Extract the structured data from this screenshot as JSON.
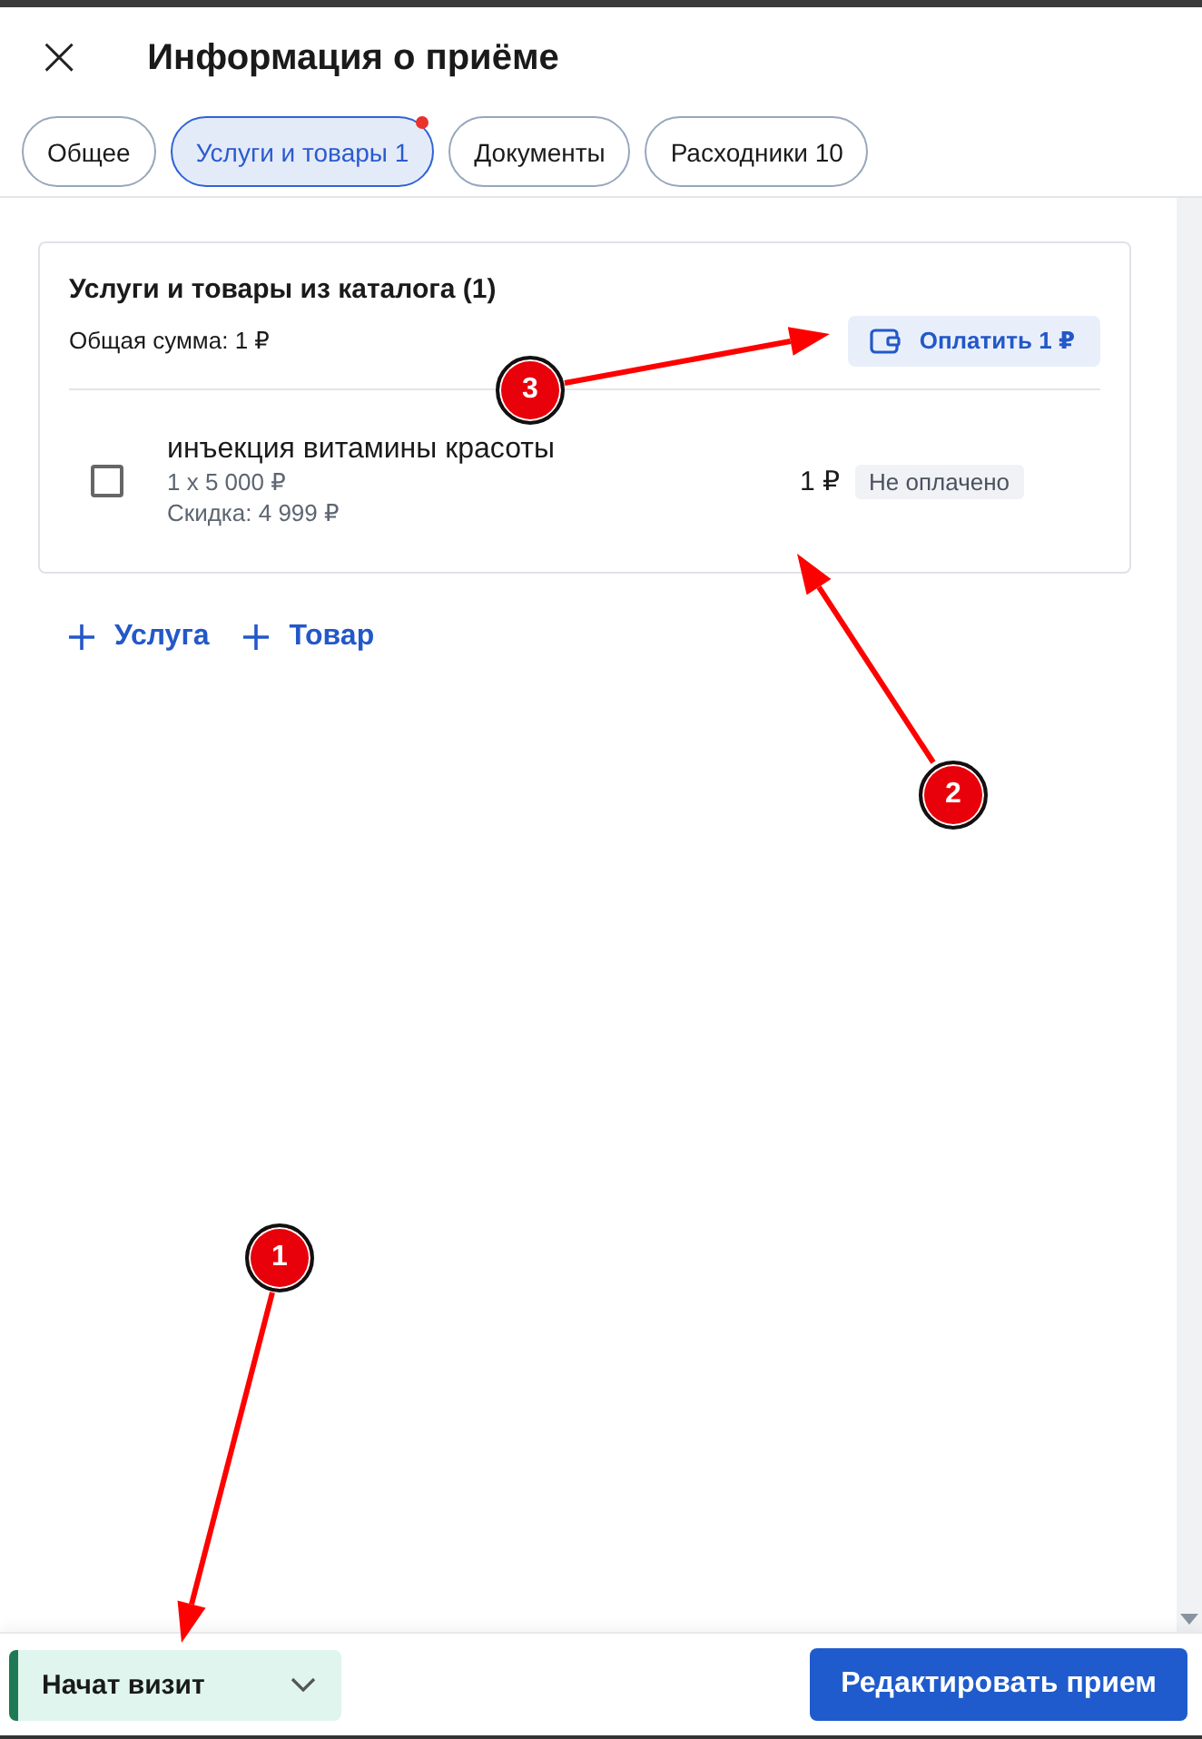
{
  "header": {
    "close": "×",
    "title": "Информация о приёме"
  },
  "tabs": [
    {
      "label": "Общее",
      "selected": false,
      "badge": false
    },
    {
      "label": "Услуги и товары 1",
      "selected": true,
      "badge": true
    },
    {
      "label": "Документы",
      "selected": false,
      "badge": false
    },
    {
      "label": "Расходники 10",
      "selected": false,
      "badge": false
    }
  ],
  "card": {
    "title": "Услуги и товары из каталога (1)",
    "total": "Общая сумма: 1 ₽",
    "pay_button": "Оплатить 1 ₽",
    "items": [
      {
        "name": "инъекция витамины красоты",
        "quantity": "1 x 5 000 ₽",
        "discount": "Скидка: 4 999 ₽",
        "price": "1 ₽",
        "status": "Не оплачено",
        "checked": false
      }
    ]
  },
  "add_buttons": [
    "Услуга",
    "Товар"
  ],
  "footer": {
    "status_button": "Начат визит",
    "edit_button": "Редактировать прием"
  },
  "annotations": [
    {
      "label": "3"
    },
    {
      "label": "2"
    },
    {
      "label": "1"
    }
  ]
}
